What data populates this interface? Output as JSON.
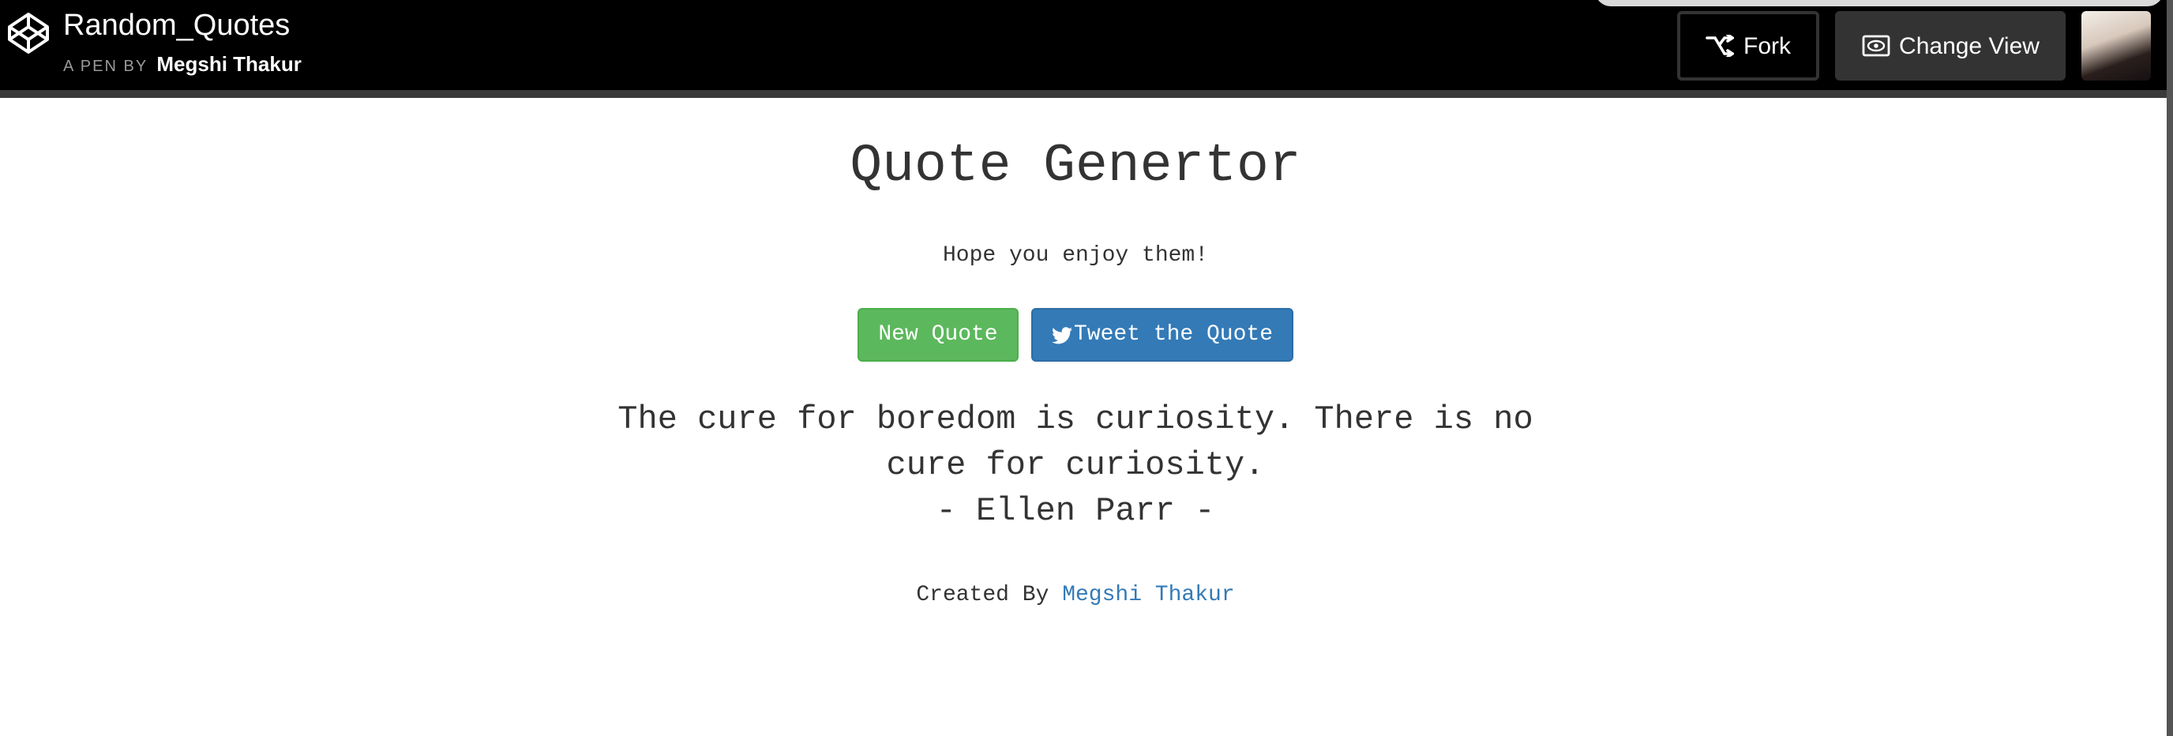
{
  "header": {
    "pen_title": "Random_Quotes",
    "pen_by_label": "A PEN BY",
    "author_name": "Megshi Thakur",
    "fork_label": "Fork",
    "change_view_label": "Change View",
    "logo_icon": "codepen-logo-icon",
    "fork_icon": "fork-icon",
    "view_icon": "eye-icon"
  },
  "main": {
    "heading": "Quote Genertor",
    "subtitle": "Hope you enjoy them!",
    "new_quote_label": "New Quote",
    "tweet_label": "Tweet the Quote",
    "tweet_icon": "twitter-bird-icon",
    "quote_text": "The cure for boredom is curiosity. There is no cure for curiosity.",
    "quote_author": "- Ellen Parr -",
    "credit_prefix": "Created By",
    "credit_name": "Megshi Thakur"
  },
  "colors": {
    "topbar": "#000000",
    "new_quote_button": "#5cb85c",
    "tweet_button": "#337ab7",
    "link": "#337ab7"
  }
}
